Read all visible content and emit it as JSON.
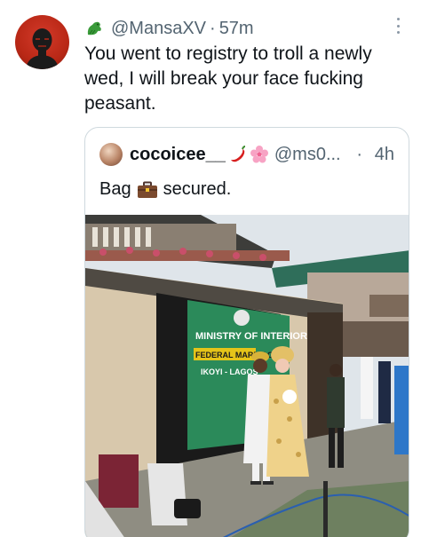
{
  "tweet": {
    "handle": "@MansaXV",
    "separator": "·",
    "time": "57m",
    "text": "You went to registry to troll a newly\nwed, I will break your face fucking\npeasant."
  },
  "quoted": {
    "name": "cocoicee__",
    "handle": "@ms0...",
    "separator": "·",
    "time": "4h",
    "text_before": "Bag",
    "text_after": "secured.",
    "sign_text_1": "MINISTRY OF INTERIOR",
    "sign_text_2": "FEDERAL MARRIAGE",
    "sign_text_3": "IKOYI - LAGOS"
  },
  "icons": {
    "badge": "dragon-icon",
    "more": "more-options-icon",
    "emoji_1": "chili-pepper-icon",
    "emoji_2": "cherry-blossom-icon",
    "bag": "briefcase-icon"
  },
  "colors": {
    "handle": "#536471",
    "text": "#0f1419",
    "border": "#cfd9de"
  }
}
